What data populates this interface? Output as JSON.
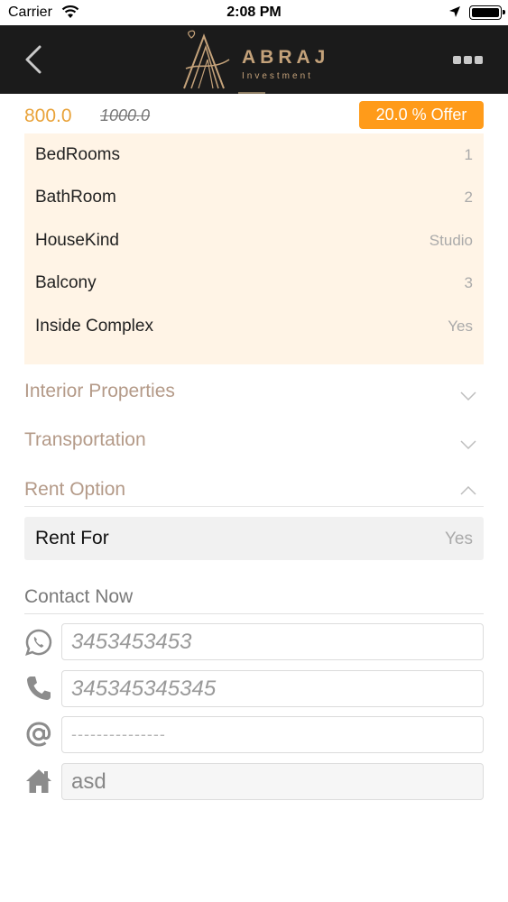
{
  "status_bar": {
    "carrier": "Carrier",
    "time": "2:08 PM"
  },
  "navbar": {
    "logo_text": "ABRAJ",
    "logo_subtitle": "Investment"
  },
  "price": {
    "current": "800.0",
    "original": "1000.0",
    "offer": "20.0 % Offer"
  },
  "details": [
    {
      "label": "BedRooms",
      "value": "1"
    },
    {
      "label": "BathRoom",
      "value": "2"
    },
    {
      "label": "HouseKind",
      "value": "Studio"
    },
    {
      "label": "Balcony",
      "value": "3"
    },
    {
      "label": "Inside Complex",
      "value": "Yes"
    }
  ],
  "sections": [
    {
      "label": "Interior Properties",
      "expanded": false
    },
    {
      "label": "Transportation",
      "expanded": false
    },
    {
      "label": "Rent Option",
      "expanded": true
    }
  ],
  "rent_option": {
    "label": "Rent For",
    "value": "Yes"
  },
  "contact": {
    "title": "Contact Now",
    "whatsapp": "3453453453",
    "phone": "345345345345",
    "email": "---------------",
    "address": "asd"
  },
  "colors": {
    "nav_background": "#1b1b1b",
    "brand_gold": "#c4a27a",
    "price": "#e9a33a",
    "offer_badge": "#ff9b1a",
    "details_background": "#fff4e6",
    "section_label": "#b49a88"
  }
}
